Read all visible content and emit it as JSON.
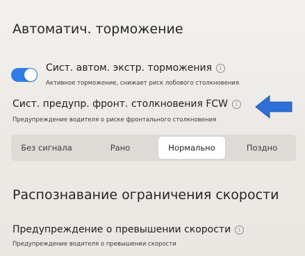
{
  "auto_braking": {
    "section_title": "Автоматич. торможение",
    "aeb": {
      "label": "Сист. автом. экстр. торможения",
      "description": "Активное торможение, снижает риск лобового столкновения",
      "enabled": true
    },
    "fcw": {
      "label": "Сист. предупр. фронт. столкновения FCW",
      "description": "Предупреждение водителя о риске фронтального столкновения",
      "options": [
        "Без сигнала",
        "Рано",
        "Нормально",
        "Поздно"
      ],
      "selected": "Нормально"
    }
  },
  "speed_limit": {
    "section_title": "Распознавание ограничения скорости",
    "overspeed": {
      "label": "Предупреждение о превышении скорости",
      "description": "Предупреждение водителя о превышении скорости"
    }
  },
  "info_glyph": "i",
  "colors": {
    "accent": "#2e7ee8",
    "arrow": "#2f6fd6",
    "background": "#eeebe7",
    "segment_bg": "#dedbd7",
    "segment_active": "#ffffff"
  },
  "icons": {
    "info": "info-icon",
    "annotation_arrow": "arrow-left-icon"
  }
}
